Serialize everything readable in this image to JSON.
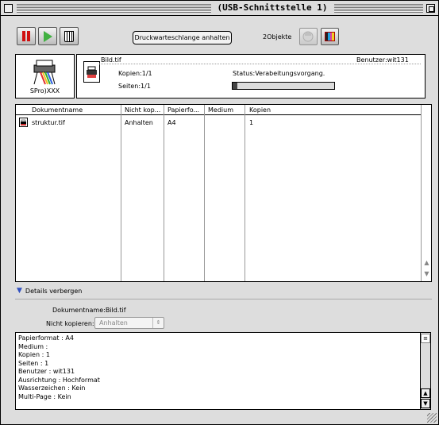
{
  "window": {
    "title": "(USB-Schnittstelle 1)"
  },
  "toolbar": {
    "pause_icon": "pause-icon",
    "play_icon": "play-icon",
    "trash_icon": "trash-icon",
    "queue_button_label": "Druckwarteschlange anhalten",
    "object_count": "2Objekte",
    "ink_icon_1": "ink-levels-icon",
    "ink_icon_2": "ink-cartridge-icon"
  },
  "printer": {
    "name": "SPro)XXX"
  },
  "current_job": {
    "filename": "Bild.tif",
    "user": "Benutzer:wit131",
    "copies": "Kopien:1/1",
    "pages": "Seiten:1/1",
    "status": "Status:Verabeitungsvorgang.",
    "progress": 0.05
  },
  "table": {
    "columns": [
      "Dokumentname",
      "Nicht kop...",
      "Papierfo...",
      "Medium",
      "Kopien"
    ],
    "rows": [
      {
        "name": "struktur.tif",
        "hold": "Anhalten",
        "paper": "A4",
        "medium": "",
        "copies": "1"
      }
    ]
  },
  "details": {
    "toggle_label": "Details verbergen",
    "document_name": "Dokumentname:Bild.tif",
    "hold_label": "Nicht kopieren:",
    "hold_value": "Anhalten",
    "info_lines": [
      "Papierformat : A4",
      "Medium :",
      "Kopien : 1",
      "Seiten : 1",
      "Benutzer : wit131",
      "Ausrichtung : Hochformat",
      "Wasserzeichen : Kein",
      "Multi-Page : Kein"
    ]
  },
  "colors": {
    "window_bg": "#dddddd",
    "pause_red": "#d01010",
    "play_green": "#40b040",
    "disclosure_blue": "#3050c0"
  }
}
